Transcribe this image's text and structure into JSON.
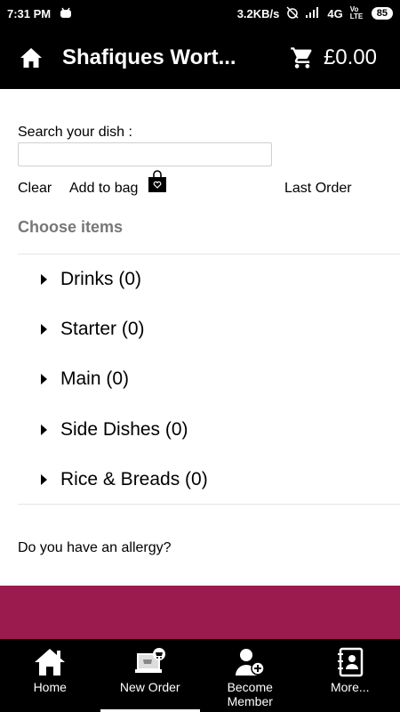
{
  "status": {
    "time": "7:31 PM",
    "speed": "3.2KB/s",
    "network": "4G",
    "volte": "Vo LTE",
    "battery": "85"
  },
  "header": {
    "title": "Shafiques Wort...",
    "cart_total": "£0.00"
  },
  "search": {
    "label": "Search your dish :",
    "value": "",
    "placeholder": ""
  },
  "actions": {
    "clear": "Clear",
    "add_to_bag": "Add to bag",
    "last_order": "Last Order"
  },
  "menu": {
    "heading": "Choose items",
    "categories": [
      {
        "label": "Drinks (0)"
      },
      {
        "label": "Starter (0)"
      },
      {
        "label": "Main (0)"
      },
      {
        "label": "Side Dishes (0)"
      },
      {
        "label": "Rice & Breads (0)"
      }
    ]
  },
  "allergy": {
    "label": "Do you have an allergy?"
  },
  "colors": {
    "banner": "#9b1b4e",
    "bars": "#000000"
  },
  "bottom_nav": [
    {
      "label": "Home",
      "icon": "home-icon"
    },
    {
      "label": "New Order",
      "icon": "new-order-icon"
    },
    {
      "label": "Become Member",
      "icon": "add-member-icon"
    },
    {
      "label": "More...",
      "icon": "contacts-book-icon"
    }
  ]
}
